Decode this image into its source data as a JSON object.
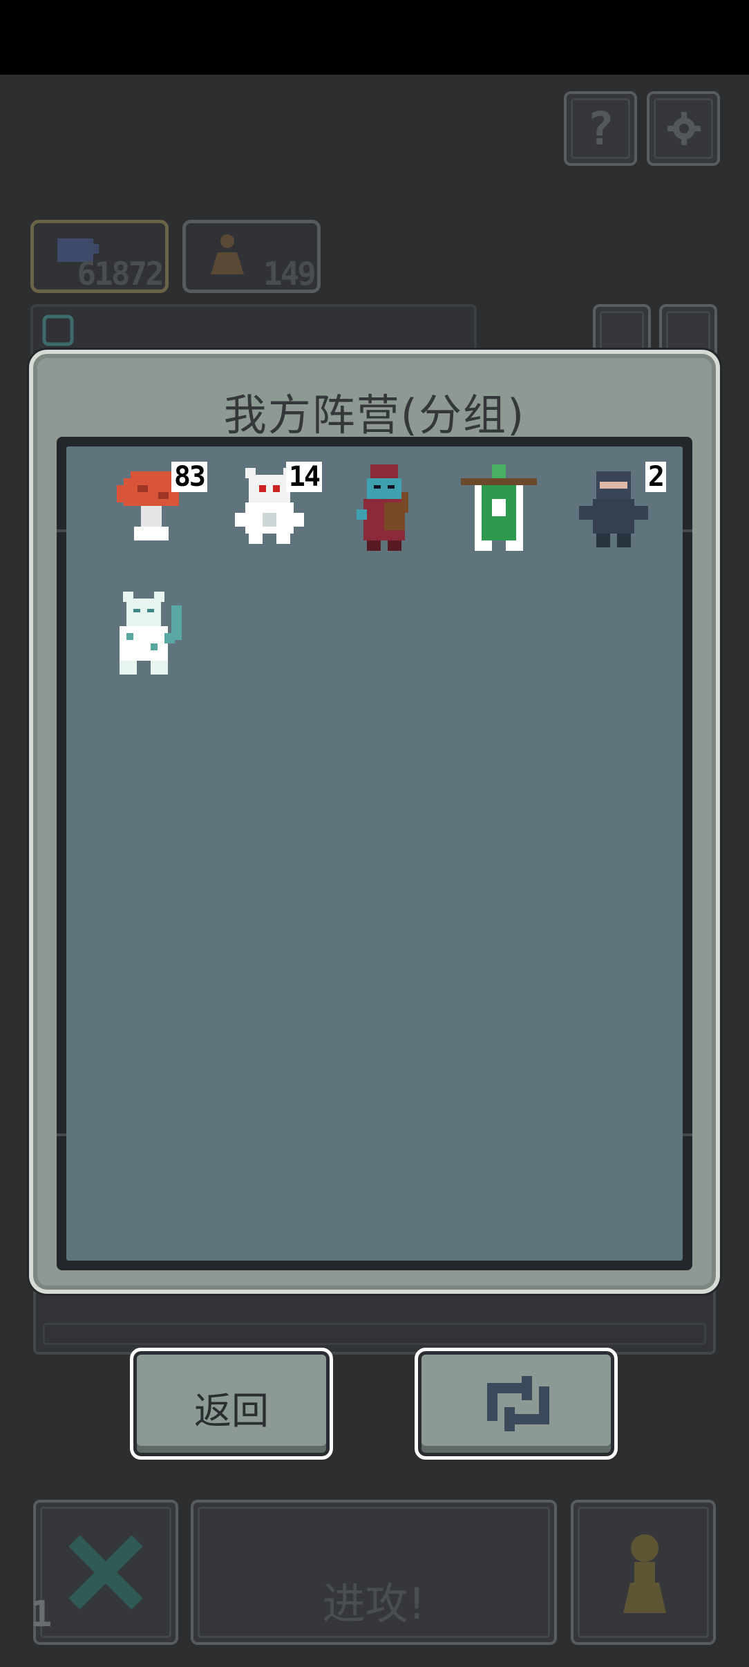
{
  "hud": {
    "help_button": "?",
    "gold_value": "61872",
    "troop_value": "149"
  },
  "modal": {
    "title": "我方阵营(分组)",
    "units": [
      {
        "icon": "mushroom-unit-icon",
        "count": "83"
      },
      {
        "icon": "white-beast-unit-icon",
        "count": "14"
      },
      {
        "icon": "blue-bard-unit-icon",
        "count": ""
      },
      {
        "icon": "green-banner-unit-icon",
        "count": ""
      },
      {
        "icon": "ninja-unit-icon",
        "count": "2"
      },
      {
        "icon": "snow-leopard-unit-icon",
        "count": ""
      }
    ]
  },
  "actions": {
    "back_label": "返回",
    "swap_icon": "swap-arrows-icon"
  },
  "bottom_bar": {
    "attack_label": "进攻!",
    "level": "1"
  },
  "colors": {
    "background": "#2d2e30",
    "modal_frame": "#8f9993",
    "unit_panel": "#5f747d",
    "button_face": "#8d9994"
  }
}
